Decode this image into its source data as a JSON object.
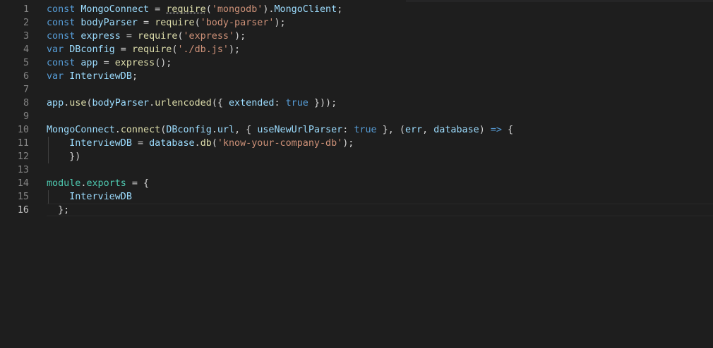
{
  "editor": {
    "active_line": "16",
    "lines": [
      {
        "num": "1",
        "tokens": [
          {
            "t": "const",
            "c": "kw"
          },
          {
            "t": " ",
            "c": "plain"
          },
          {
            "t": "MongoConnect",
            "c": "var"
          },
          {
            "t": " = ",
            "c": "plain"
          },
          {
            "t": "require",
            "c": "fn",
            "squiggle": true
          },
          {
            "t": "(",
            "c": "plain"
          },
          {
            "t": "'mongodb'",
            "c": "str"
          },
          {
            "t": ").",
            "c": "plain"
          },
          {
            "t": "MongoClient",
            "c": "var"
          },
          {
            "t": ";",
            "c": "plain"
          }
        ]
      },
      {
        "num": "2",
        "tokens": [
          {
            "t": "const",
            "c": "kw"
          },
          {
            "t": " ",
            "c": "plain"
          },
          {
            "t": "bodyParser",
            "c": "var"
          },
          {
            "t": " = ",
            "c": "plain"
          },
          {
            "t": "require",
            "c": "fn"
          },
          {
            "t": "(",
            "c": "plain"
          },
          {
            "t": "'body-parser'",
            "c": "str"
          },
          {
            "t": ");",
            "c": "plain"
          }
        ]
      },
      {
        "num": "3",
        "tokens": [
          {
            "t": "const",
            "c": "kw"
          },
          {
            "t": " ",
            "c": "plain"
          },
          {
            "t": "express",
            "c": "var"
          },
          {
            "t": " = ",
            "c": "plain"
          },
          {
            "t": "require",
            "c": "fn"
          },
          {
            "t": "(",
            "c": "plain"
          },
          {
            "t": "'express'",
            "c": "str"
          },
          {
            "t": ");",
            "c": "plain"
          }
        ]
      },
      {
        "num": "4",
        "tokens": [
          {
            "t": "var",
            "c": "kw"
          },
          {
            "t": " ",
            "c": "plain"
          },
          {
            "t": "DBconfig",
            "c": "var"
          },
          {
            "t": " = ",
            "c": "plain"
          },
          {
            "t": "require",
            "c": "fn"
          },
          {
            "t": "(",
            "c": "plain"
          },
          {
            "t": "'./db.js'",
            "c": "str"
          },
          {
            "t": ");",
            "c": "plain"
          }
        ]
      },
      {
        "num": "5",
        "tokens": [
          {
            "t": "const",
            "c": "kw"
          },
          {
            "t": " ",
            "c": "plain"
          },
          {
            "t": "app",
            "c": "var"
          },
          {
            "t": " = ",
            "c": "plain"
          },
          {
            "t": "express",
            "c": "fn"
          },
          {
            "t": "();",
            "c": "plain"
          }
        ]
      },
      {
        "num": "6",
        "tokens": [
          {
            "t": "var",
            "c": "kw"
          },
          {
            "t": " ",
            "c": "plain"
          },
          {
            "t": "InterviewDB",
            "c": "var"
          },
          {
            "t": ";",
            "c": "plain"
          }
        ]
      },
      {
        "num": "7",
        "tokens": []
      },
      {
        "num": "8",
        "tokens": [
          {
            "t": "app",
            "c": "var"
          },
          {
            "t": ".",
            "c": "plain"
          },
          {
            "t": "use",
            "c": "fn"
          },
          {
            "t": "(",
            "c": "plain"
          },
          {
            "t": "bodyParser",
            "c": "var"
          },
          {
            "t": ".",
            "c": "plain"
          },
          {
            "t": "urlencoded",
            "c": "fn"
          },
          {
            "t": "({ ",
            "c": "plain"
          },
          {
            "t": "extended",
            "c": "var"
          },
          {
            "t": ": ",
            "c": "plain"
          },
          {
            "t": "true",
            "c": "kw"
          },
          {
            "t": " }));",
            "c": "plain"
          }
        ]
      },
      {
        "num": "9",
        "tokens": []
      },
      {
        "num": "10",
        "tokens": [
          {
            "t": "MongoConnect",
            "c": "var"
          },
          {
            "t": ".",
            "c": "plain"
          },
          {
            "t": "connect",
            "c": "fn"
          },
          {
            "t": "(",
            "c": "plain"
          },
          {
            "t": "DBconfig",
            "c": "var"
          },
          {
            "t": ".",
            "c": "plain"
          },
          {
            "t": "url",
            "c": "var"
          },
          {
            "t": ", { ",
            "c": "plain"
          },
          {
            "t": "useNewUrlParser",
            "c": "var"
          },
          {
            "t": ": ",
            "c": "plain"
          },
          {
            "t": "true",
            "c": "kw"
          },
          {
            "t": " }, (",
            "c": "plain"
          },
          {
            "t": "err",
            "c": "var"
          },
          {
            "t": ", ",
            "c": "plain"
          },
          {
            "t": "database",
            "c": "var"
          },
          {
            "t": ") ",
            "c": "plain"
          },
          {
            "t": "=>",
            "c": "kw"
          },
          {
            "t": " {",
            "c": "plain"
          }
        ]
      },
      {
        "num": "11",
        "tokens": [
          {
            "t": "    ",
            "c": "plain"
          },
          {
            "t": "InterviewDB",
            "c": "var"
          },
          {
            "t": " = ",
            "c": "plain"
          },
          {
            "t": "database",
            "c": "var"
          },
          {
            "t": ".",
            "c": "plain"
          },
          {
            "t": "db",
            "c": "fn"
          },
          {
            "t": "(",
            "c": "plain"
          },
          {
            "t": "'know-your-company-db'",
            "c": "str"
          },
          {
            "t": ");",
            "c": "plain"
          }
        ]
      },
      {
        "num": "12",
        "tokens": [
          {
            "t": "    ",
            "c": "plain"
          },
          {
            "t": "})",
            "c": "plain"
          }
        ]
      },
      {
        "num": "13",
        "tokens": []
      },
      {
        "num": "14",
        "tokens": [
          {
            "t": "module",
            "c": "cls"
          },
          {
            "t": ".",
            "c": "plain"
          },
          {
            "t": "exports",
            "c": "cls"
          },
          {
            "t": " = {",
            "c": "plain"
          }
        ]
      },
      {
        "num": "15",
        "tokens": [
          {
            "t": "    ",
            "c": "plain"
          },
          {
            "t": "InterviewDB",
            "c": "var"
          }
        ]
      },
      {
        "num": "16",
        "tokens": [
          {
            "t": "  ",
            "c": "plain"
          },
          {
            "t": "};",
            "c": "plain"
          }
        ]
      }
    ]
  }
}
